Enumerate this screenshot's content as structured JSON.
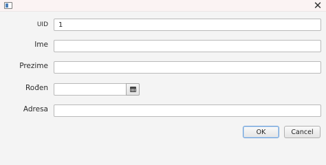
{
  "window": {
    "close_symbol": "✕"
  },
  "form": {
    "uid": {
      "label": "UID",
      "value": "1"
    },
    "ime": {
      "label": "Ime",
      "value": ""
    },
    "prezime": {
      "label": "Prezime",
      "value": ""
    },
    "roden": {
      "label": "Rođen",
      "value": "",
      "picker_icon": "calendar-icon"
    },
    "adresa": {
      "label": "Adresa",
      "value": ""
    }
  },
  "buttons": {
    "ok": "OK",
    "cancel": "Cancel"
  }
}
